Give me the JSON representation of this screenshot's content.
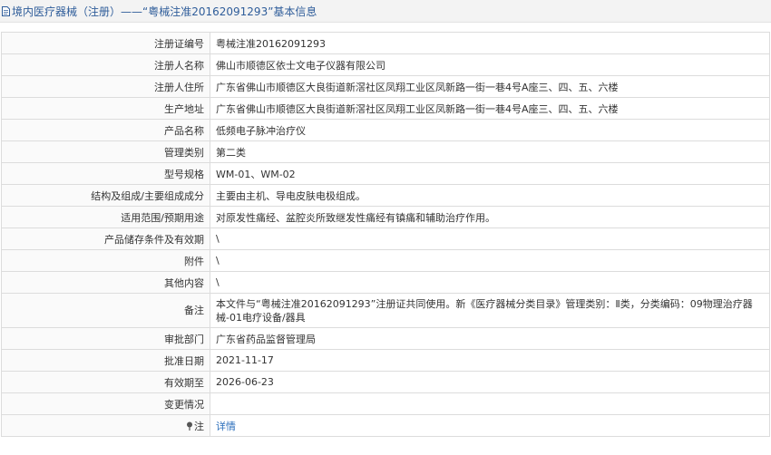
{
  "header": {
    "title": "境内医疗器械（注册）——“粤械注准20162091293”基本信息"
  },
  "rows": [
    {
      "label": "注册证编号",
      "value": "粤械注准20162091293"
    },
    {
      "label": "注册人名称",
      "value": "佛山市顺德区依士文电子仪器有限公司"
    },
    {
      "label": "注册人住所",
      "value": "广东省佛山市顺德区大良街道新滘社区凤翔工业区凤新路一街一巷4号A座三、四、五、六楼"
    },
    {
      "label": "生产地址",
      "value": "广东省佛山市顺德区大良街道新滘社区凤翔工业区凤新路一街一巷4号A座三、四、五、六楼"
    },
    {
      "label": "产品名称",
      "value": "低频电子脉冲治疗仪"
    },
    {
      "label": "管理类别",
      "value": "第二类"
    },
    {
      "label": "型号规格",
      "value": "WM-01、WM-02"
    },
    {
      "label": "结构及组成/主要组成成分",
      "value": "主要由主机、导电皮肤电极组成。"
    },
    {
      "label": "适用范围/预期用途",
      "value": "对原发性痛经、盆腔炎所致继发性痛经有镇痛和辅助治疗作用。"
    },
    {
      "label": "产品储存条件及有效期",
      "value": "\\"
    },
    {
      "label": "附件",
      "value": "\\"
    },
    {
      "label": "其他内容",
      "value": "\\"
    },
    {
      "label": "备注",
      "value": "本文件与“粤械注准20162091293”注册证共同使用。新《医疗器械分类目录》管理类别：Ⅱ类，分类编码：09物理治疗器械-01电疗设备/器具"
    },
    {
      "label": "审批部门",
      "value": "广东省药品监督管理局"
    },
    {
      "label": "批准日期",
      "value": "2021-11-17"
    },
    {
      "label": "有效期至",
      "value": "2026-06-23"
    },
    {
      "label": "变更情况",
      "value": ""
    }
  ],
  "footer_row": {
    "label": "注",
    "link": "详情"
  },
  "colors": {
    "title_text": "#2f5d9a",
    "link": "#2a6ebb",
    "border": "#dcdcdc"
  }
}
